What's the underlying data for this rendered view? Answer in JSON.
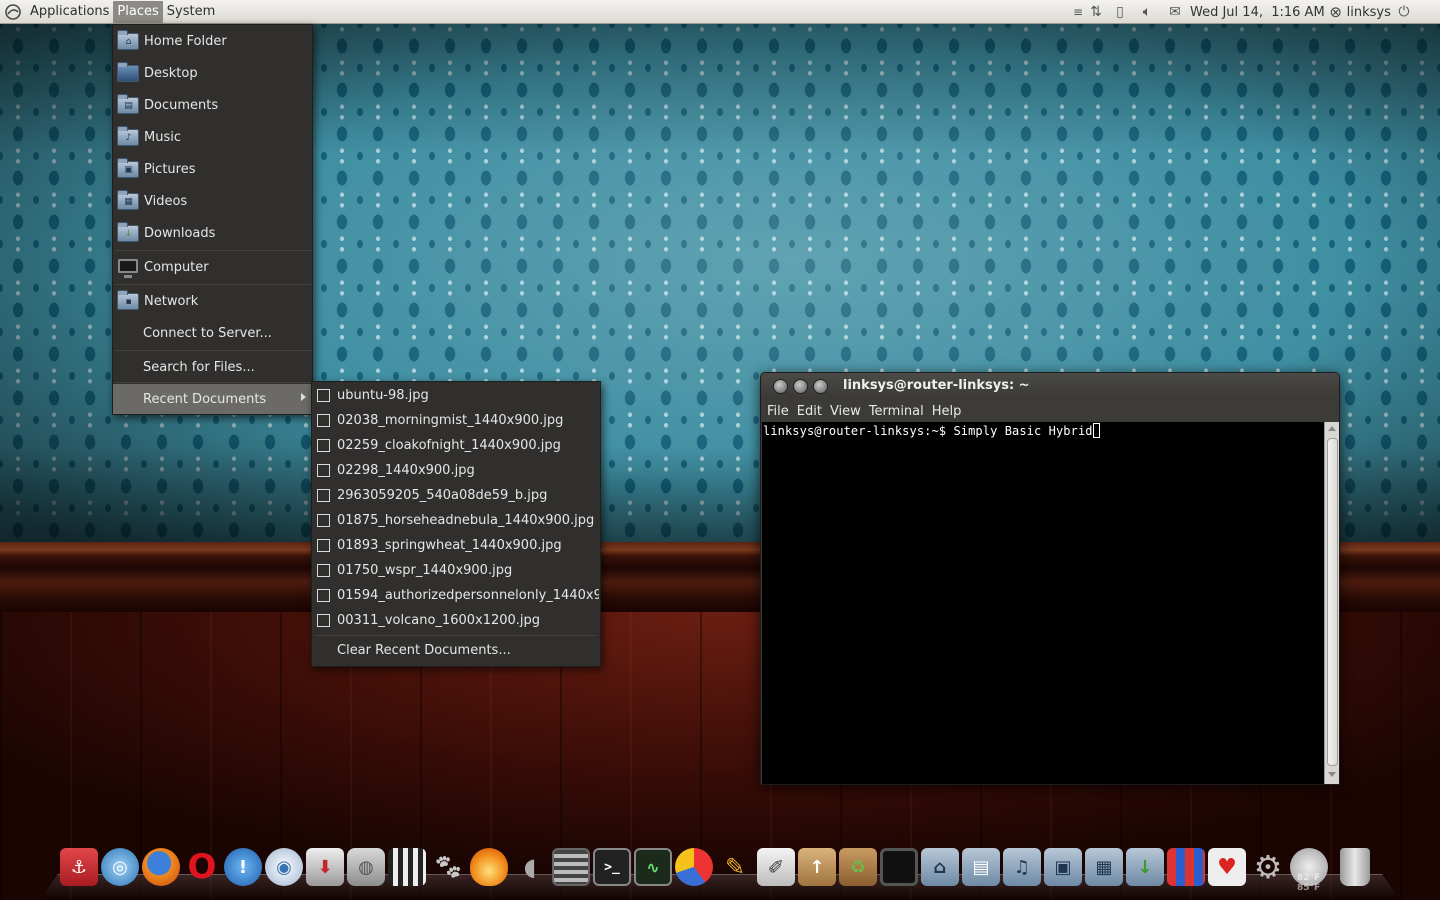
{
  "top_panel": {
    "menus": [
      "Applications",
      "Places",
      "System"
    ],
    "datetime": "Wed Jul 14,  1:16 AM",
    "user": "linksys"
  },
  "places_menu": {
    "items": [
      {
        "label": "Home Folder",
        "icon": "home-folder-icon"
      },
      {
        "label": "Desktop",
        "icon": "desktop-folder-icon"
      },
      {
        "label": "Documents",
        "icon": "documents-folder-icon"
      },
      {
        "label": "Music",
        "icon": "music-folder-icon"
      },
      {
        "label": "Pictures",
        "icon": "pictures-folder-icon"
      },
      {
        "label": "Videos",
        "icon": "videos-folder-icon"
      },
      {
        "label": "Downloads",
        "icon": "downloads-folder-icon"
      },
      {
        "label": "Computer",
        "icon": "computer-icon"
      },
      {
        "label": "Network",
        "icon": "network-folder-icon"
      },
      {
        "label": "Connect to Server...",
        "icon": ""
      },
      {
        "label": "Search for Files...",
        "icon": ""
      },
      {
        "label": "Recent Documents",
        "icon": ""
      }
    ]
  },
  "recent_documents": {
    "files": [
      "ubuntu-98.jpg",
      "02038_morningmist_1440x900.jpg",
      "02259_cloakofnight_1440x900.jpg",
      "02298_1440x900.jpg",
      "2963059205_540a08de59_b.jpg",
      "01875_horseheadnebula_1440x900.jpg",
      "01893_springwheat_1440x900.jpg",
      "01750_wspr_1440x900.jpg",
      "01594_authorizedpersonnelonly_1440x9...",
      "00311_volcano_1600x1200.jpg"
    ],
    "clear_label": "Clear Recent Documents..."
  },
  "terminal": {
    "title": "linksys@router-linksys: ~",
    "menu": [
      "File",
      "Edit",
      "View",
      "Terminal",
      "Help"
    ],
    "prompt_line": "linksys@router-linksys:~$ Simply Basic Hybrid"
  },
  "dock": {
    "icons": [
      "anchor-icon",
      "network-globe-icon",
      "firefox-icon",
      "opera-icon",
      "chat-bubble-icon",
      "web-browser-icon",
      "download-manager-icon",
      "disk-utility-icon",
      "video-editor-icon",
      "gimp-icon",
      "flame-icon",
      "speaker-icon",
      "calculator-icon",
      "terminal-icon",
      "system-monitor-icon",
      "pie-chart-icon",
      "paint-palette-icon",
      "text-editor-icon",
      "archive-icon",
      "software-package-icon",
      "display-icon",
      "home-folder-icon",
      "documents-folder-icon",
      "music-folder-icon",
      "pictures-folder-icon",
      "videos-folder-icon",
      "downloads-folder-icon",
      "tetris-icon",
      "cards-game-icon",
      "settings-gear-icon",
      "weather-icon",
      "trash-icon"
    ],
    "weather_temp": "82°F",
    "weather_sub": "85°F"
  },
  "colors": {
    "panel": "#dcdad4",
    "menu_bg": "#302f2d",
    "menu_highlight": "#6b6a66",
    "wallpaper_teal": "#3f8fa2"
  }
}
